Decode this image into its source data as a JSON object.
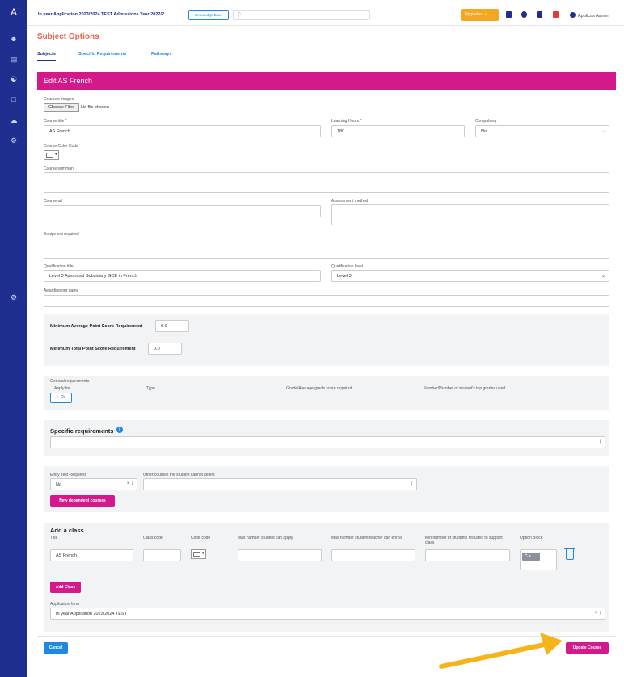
{
  "app": {
    "logo": "A",
    "title": "In year Application 2023/2024 TEST Admissions Year 2022/2...",
    "knowledge_base": "Knowledge Base",
    "upgrades": "Upgrades",
    "user": "Applicas Admin"
  },
  "page": {
    "title": "Subject Options",
    "tabs": [
      "Subjects",
      "Specific Requirements",
      "Pathways"
    ]
  },
  "form": {
    "header": "Edit AS French",
    "course_images_label": "Course's images",
    "choose_files": "Choose Files",
    "no_file": "No file chosen",
    "course_title_label": "Course title *",
    "course_title_value": "AS French",
    "learning_hours_label": "Learning Hours *",
    "learning_hours_value": "180",
    "compulsory_label": "Compulsory",
    "compulsory_value": "No",
    "course_color_label": "Course Color Code",
    "course_summary_label": "Course summary",
    "course_url_label": "Course url",
    "assessment_method_label": "Assessment method",
    "equipment_label": "Equipment required",
    "qualification_title_label": "Qualification title",
    "qualification_title_value": "Level 3 Advanced Subsidiary GCE in French",
    "qualification_level_label": "Qualification level",
    "qualification_level_value": "Level 3",
    "awarding_label": "Awarding org name"
  },
  "scores": {
    "min_avg_label": "Minimum Average Point Score Requirement",
    "min_avg_value": "0.0",
    "min_total_label": "Minimum Total Point Score Requirement",
    "min_total_value": "0.0"
  },
  "general": {
    "label": "General requirements",
    "cols": [
      "Apply for",
      "Type",
      "Grade/Average grade score required",
      "Number/Number of student's top grades used"
    ],
    "or_button": "+ Or"
  },
  "specific": {
    "title": "Specific requirements"
  },
  "entry": {
    "entry_test_label": "Entry Test Required",
    "entry_test_value": "No",
    "other_courses_label": "Other courses the student cannot select",
    "new_dependent": "New dependent courses"
  },
  "add_class": {
    "title": "Add a class",
    "cols": [
      "Title",
      "Class code",
      "Color code",
      "Max number student can apply",
      "Max number student teacher can enroll",
      "Min number of students required to support class",
      "Option Block"
    ],
    "title_value": "AS French",
    "option_tag": "C",
    "add_button": "Add Class",
    "app_form_label": "Application form",
    "app_form_value": "In year Application 2023/2024 TEST"
  },
  "footer": {
    "cancel": "Cancel",
    "update": "Update Course"
  },
  "colors": {
    "sidebar": "#1e2f8f",
    "header_pink": "#d4198a",
    "title_orange": "#e8644f",
    "blue": "#1e88e5",
    "upgrades": "#f5a623",
    "arrow": "#f5b41a"
  }
}
